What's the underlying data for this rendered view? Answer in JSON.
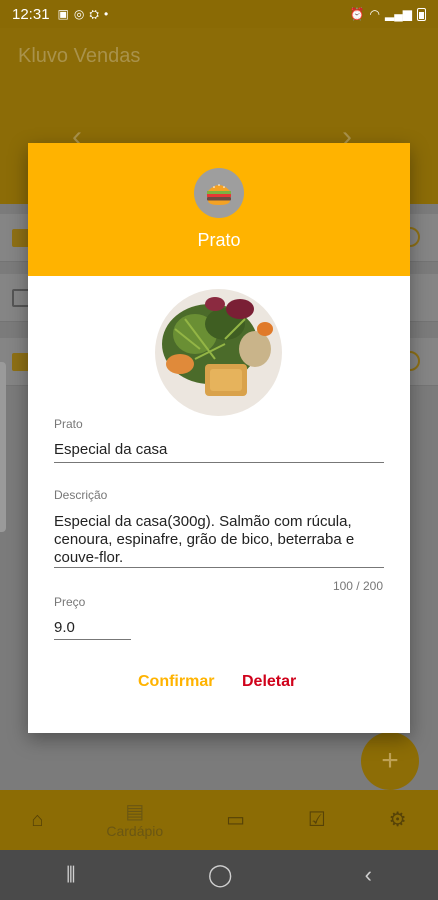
{
  "status_bar": {
    "time": "12:31"
  },
  "app": {
    "title": "Kluvo Vendas",
    "fab_label": "+",
    "bottom_nav": [
      {
        "label": "",
        "icon": "home-icon"
      },
      {
        "label": "Cardápio",
        "icon": "menu-book-icon"
      },
      {
        "label": "",
        "icon": "ticket-icon"
      },
      {
        "label": "",
        "icon": "checklist-icon"
      },
      {
        "label": "",
        "icon": "gear-icon"
      }
    ]
  },
  "dialog": {
    "title": "Prato",
    "header_icon": "hamburger-icon",
    "fields": {
      "name_label": "Prato",
      "name_value": "Especial da casa",
      "description_label": "Descrição",
      "description_value": "Especial da casa(300g). Salmão com rúcula, cenoura, espinafre, grão de bico, beterraba e couve-flor.",
      "char_counter": "100 / 200",
      "price_label": "Preço",
      "price_value": "9.0"
    },
    "buttons": {
      "confirm": "Confirmar",
      "delete": "Deletar"
    },
    "colors": {
      "accent": "#ffb300",
      "danger": "#d0021b"
    }
  }
}
